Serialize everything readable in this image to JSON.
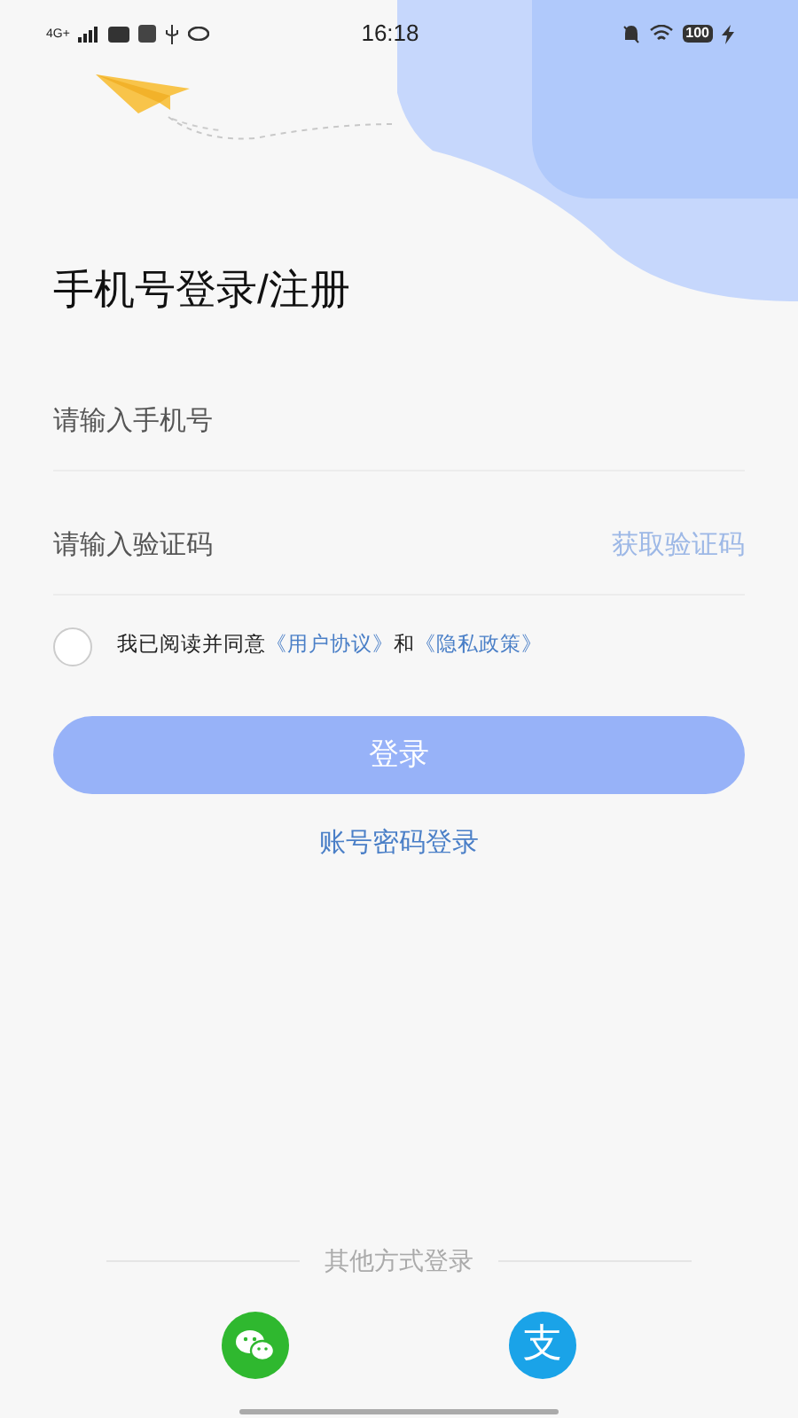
{
  "status_bar": {
    "network": "4G+",
    "time": "16:18",
    "battery": "100"
  },
  "title": "手机号登录/注册",
  "phone_field": {
    "placeholder": "请输入手机号"
  },
  "code_field": {
    "placeholder": "请输入验证码",
    "action": "获取验证码"
  },
  "agreement": {
    "checked": false,
    "parts": [
      {
        "kind": "text",
        "text": "我已阅读并同意"
      },
      {
        "kind": "link",
        "text": "《用户协议》"
      },
      {
        "kind": "text",
        "text": "和"
      },
      {
        "kind": "link",
        "text": "《隐私政策》"
      }
    ]
  },
  "login_button": {
    "label": "登录",
    "disabled": true
  },
  "password_login_link": "账号密码登录",
  "other_methods": {
    "label": "其他方式登录",
    "methods": [
      {
        "kind": "wechat"
      },
      {
        "kind": "alipay",
        "glyph": "支"
      }
    ]
  }
}
